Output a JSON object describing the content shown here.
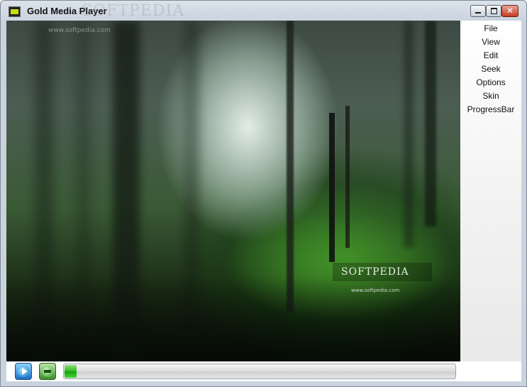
{
  "window": {
    "title": "Gold Media Player",
    "title_watermark": "SOFTPEDIA",
    "caption_buttons": {
      "minimize": "",
      "maximize": "",
      "close": "✕"
    }
  },
  "video": {
    "watermark_url_top": "www.softpedia.com",
    "logo_text": "SOFTPEDIA",
    "logo_url": "www.softpedia.com"
  },
  "menu": {
    "items": [
      "File",
      "View",
      "Edit",
      "Seek",
      "Options",
      "Skin",
      "ProgressBar"
    ]
  },
  "controls": {
    "play_icon": "play-icon",
    "stop_icon": "stop-icon",
    "progress_fraction": 0.03
  },
  "colors": {
    "progress_fill": "#2eb81d",
    "close_button": "#c43c22"
  }
}
